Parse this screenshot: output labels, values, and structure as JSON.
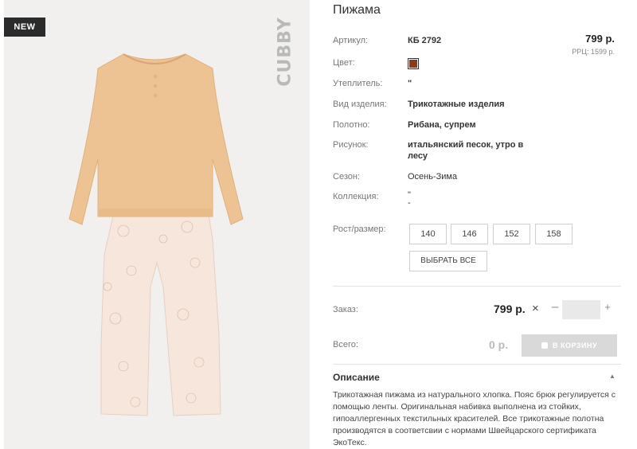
{
  "product": {
    "badge": "NEW",
    "brand": "CUBBY",
    "title": "Пижама",
    "price": "799 р.",
    "rrp": "РРЦ: 1599 р."
  },
  "attributes": {
    "article_label": "Артикул:",
    "article_value": "КБ 2792",
    "color_label": "Цвет:",
    "color_hex": "#8a3c1e",
    "insulation_label": "Утеплитель:",
    "insulation_value": "\"",
    "type_label": "Вид изделия:",
    "type_value": "Трикотажные изделия",
    "fabric_label": "Полотно:",
    "fabric_value": "Рибана, супрем",
    "pattern_label": "Рисунок:",
    "pattern_value_line1": "итальянский песок, утро в",
    "pattern_value_line2": "лесу",
    "season_label": "Сезон:",
    "season_value": "Осень-Зима",
    "collection_label": "Коллекция:",
    "collection_value_line1": "\"",
    "collection_value_line2": "-"
  },
  "sizes": {
    "label": "Рост/размер:",
    "options": [
      "140",
      "146",
      "152",
      "158"
    ],
    "select_all": "ВЫБРАТЬ ВСЕ"
  },
  "order": {
    "label": "Заказ:",
    "price": "799 р.",
    "times": "×",
    "minus": "–",
    "plus": "+",
    "quantity": ""
  },
  "total": {
    "label": "Всего:",
    "value": "0 р.",
    "cart_button": "В КОРЗИНУ"
  },
  "description": {
    "heading": "Описание",
    "text": "Трикотажная пижама из натурального хлопка. Пояс брюк регулируется с помощью ленты. Оригинальная набивка выполнена из стойких, гипоаллергенных текстильных красителей. Все трикотажные полотна производятся в соответсвии с нормами Швейцарского сертификата ЭкоТекс."
  }
}
